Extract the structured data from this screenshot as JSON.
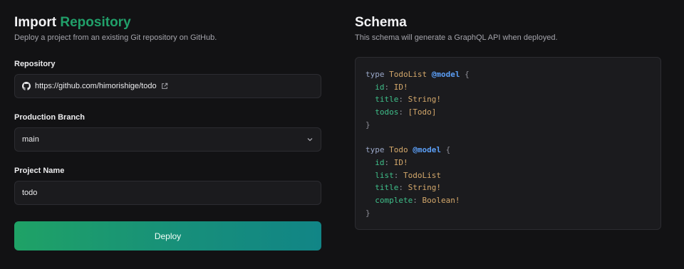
{
  "import": {
    "title_prefix": "Import",
    "title_accent": "Repository",
    "subtitle": "Deploy a project from an existing Git repository on GitHub.",
    "repository_label": "Repository",
    "repository_url": "https://github.com/himorishige/todo",
    "branch_label": "Production Branch",
    "branch_value": "main",
    "project_label": "Project Name",
    "project_value": "todo",
    "deploy_label": "Deploy"
  },
  "schema": {
    "title": "Schema",
    "subtitle": "This schema will generate a GraphQL API when deployed.",
    "types": [
      {
        "keyword": "type",
        "name": "TodoList",
        "directive": "@model",
        "open": "{",
        "close": "}",
        "fields": [
          {
            "name": "id",
            "type": "ID!"
          },
          {
            "name": "title",
            "type": "String!"
          },
          {
            "name": "todos",
            "type": "[Todo]"
          }
        ]
      },
      {
        "keyword": "type",
        "name": "Todo",
        "directive": "@model",
        "open": "{",
        "close": "}",
        "fields": [
          {
            "name": "id",
            "type": "ID!"
          },
          {
            "name": "list",
            "type": "TodoList"
          },
          {
            "name": "title",
            "type": "String!"
          },
          {
            "name": "complete",
            "type": "Boolean!"
          }
        ]
      }
    ]
  },
  "icons": {
    "repo_icon": "github-icon",
    "external_icon": "external-link-icon",
    "select_icon": "chevron-down-icon"
  },
  "colors": {
    "accent": "#21a06a",
    "button_start": "#1fa266",
    "button_end": "#118586",
    "background": "#121214",
    "panel": "#1b1b1e"
  }
}
